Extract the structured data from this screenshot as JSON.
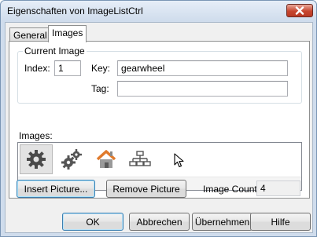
{
  "window": {
    "title": "Eigenschaften von ImageListCtrl"
  },
  "tabs": [
    {
      "label": "General",
      "active": false
    },
    {
      "label": "Images",
      "active": true
    }
  ],
  "current_image": {
    "group_label": "Current Image",
    "index_label": "Index:",
    "index_value": "1",
    "key_label": "Key:",
    "key_value": "gearwheel",
    "tag_label": "Tag:",
    "tag_value": ""
  },
  "images": {
    "label": "Images:",
    "items": [
      {
        "icon": "gearwheel-icon",
        "selected": true
      },
      {
        "icon": "gears-icon",
        "selected": false
      },
      {
        "icon": "house-icon",
        "selected": false
      },
      {
        "icon": "org-chart-icon",
        "selected": false
      }
    ]
  },
  "actions": {
    "insert_label": "Insert Picture...",
    "remove_label": "Remove Picture",
    "count_label": "Image Count:",
    "count_value": "4"
  },
  "footer": {
    "ok_label": "OK",
    "cancel_label": "Abbrechen",
    "apply_label": "Übernehmen",
    "help_label": "Hilfe"
  },
  "colors": {
    "title_gradient_top": "#e6eef8",
    "close_button": "#c7462f",
    "focus_border": "#3c7fb1",
    "house_roof": "#e07a2c"
  }
}
